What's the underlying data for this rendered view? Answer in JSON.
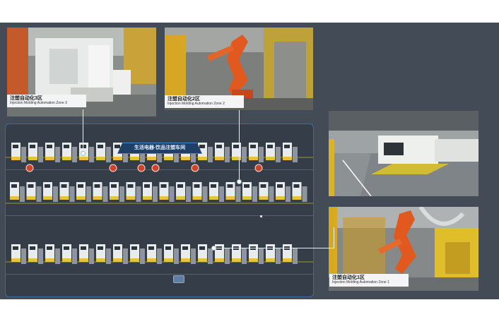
{
  "floor_plan": {
    "title": "生活电器-饮品注塑车间"
  },
  "zones": [
    {
      "cn": "注塑自动化3区",
      "en": "Injection Molding Automation Zone 3"
    },
    {
      "cn": "注塑自动化2区",
      "en": "Injection Molding Automation Zone 2"
    },
    {
      "cn": "注塑自动化1区",
      "en": "Injection Molding Automation Zone 1"
    }
  ],
  "colors": {
    "background": "#434b56",
    "floor_border": "#3c6a9c",
    "title_bar": "#1f3f66",
    "machine_white": "#e9ecef",
    "machine_yellow": "#e5c43b",
    "robot_orange": "#e1591e",
    "warning_red": "#d0422a"
  }
}
